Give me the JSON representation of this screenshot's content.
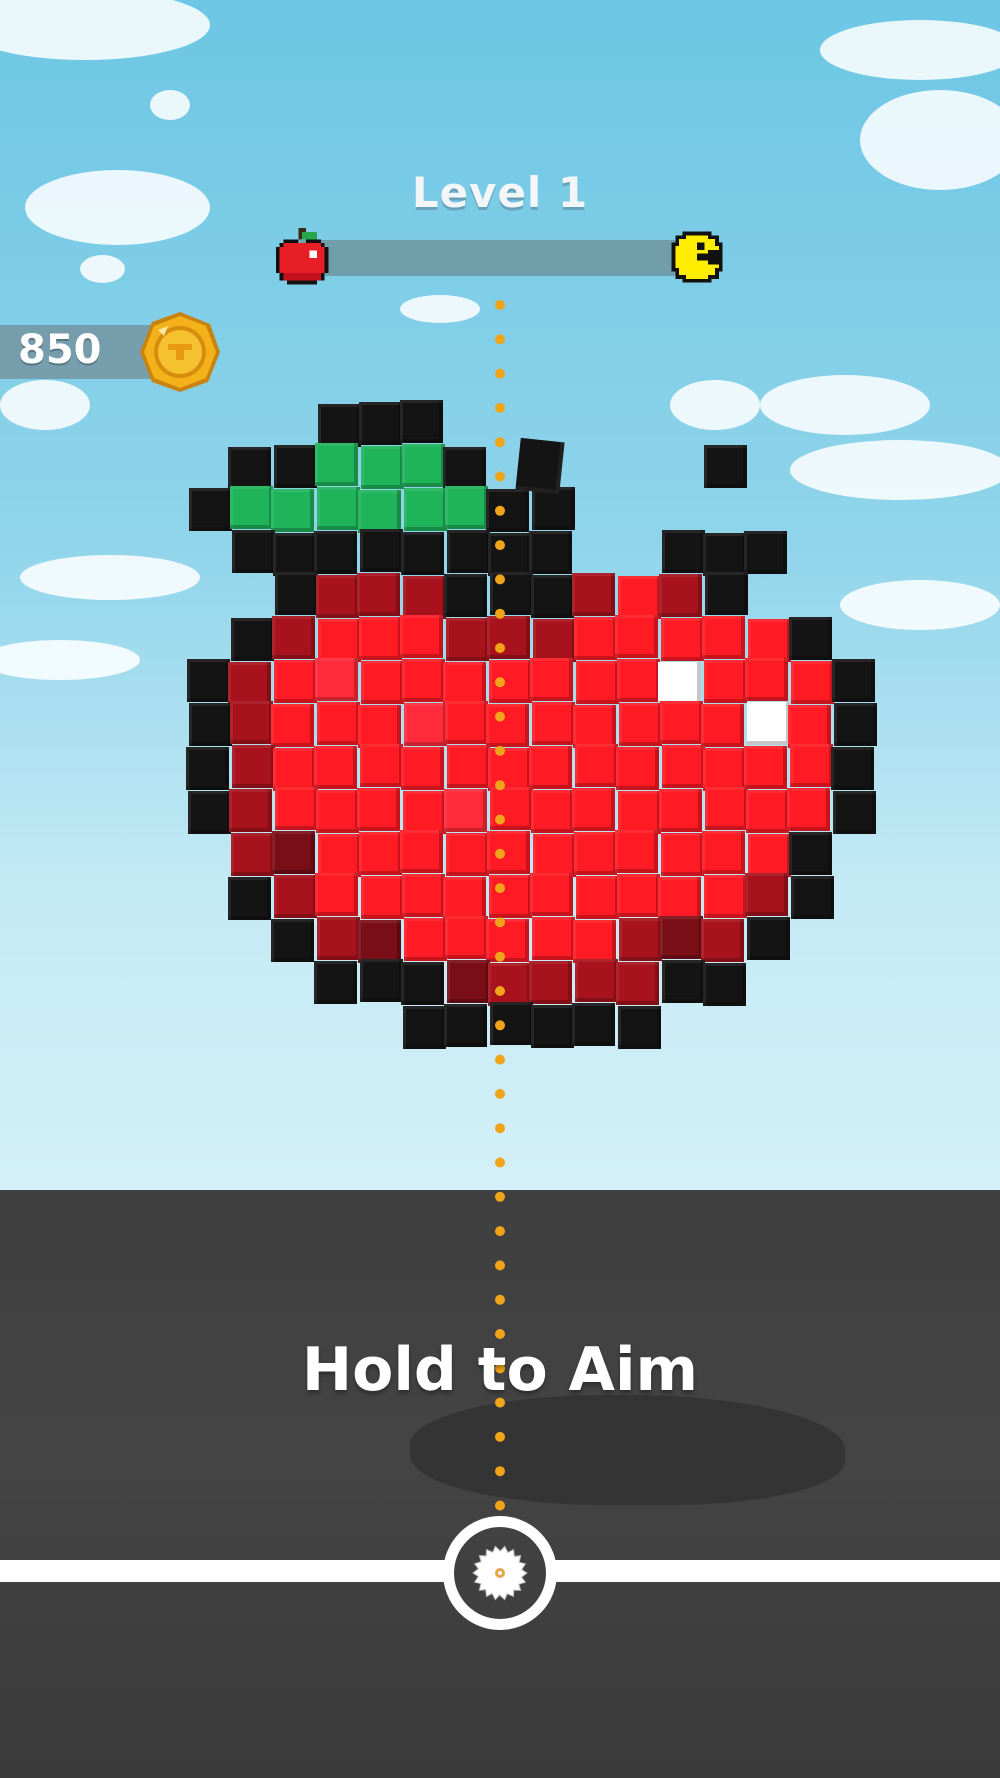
{
  "hud": {
    "level_label": "Level 1",
    "progress": 0.0,
    "progress_start_icon": "apple-icon",
    "progress_end_icon": "pacman-icon",
    "coins": "850",
    "coin_icon": "coin-icon"
  },
  "hint": {
    "text": "Hold to Aim"
  },
  "launcher": {
    "icon": "saw-blade-icon"
  },
  "target": {
    "shape": "voxel-apple"
  },
  "colors": {
    "apple_red": "#ff1a24",
    "apple_dark_red": "#a8121c",
    "leaf_green": "#1fb35a",
    "outline": "#141414",
    "aim_dots": "#f0a419",
    "coin_gold": "#f4b21a",
    "pacman_yellow": "#ffee00",
    "ground": "#404040"
  }
}
